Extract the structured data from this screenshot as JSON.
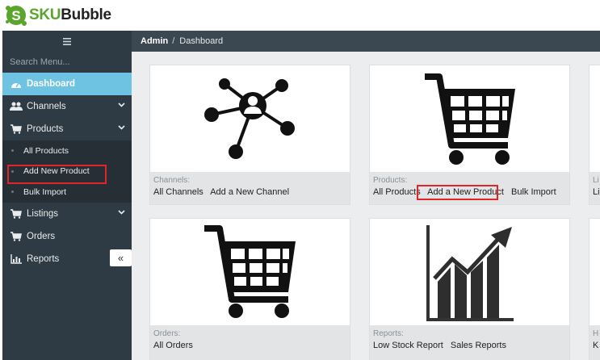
{
  "brand": {
    "name_green": "SKU",
    "name_dark": "Bubble"
  },
  "sidebar": {
    "search_placeholder": "Search Menu...",
    "items": [
      {
        "label": "Dashboard"
      },
      {
        "label": "Channels"
      },
      {
        "label": "Products"
      },
      {
        "label": "Listings"
      },
      {
        "label": "Orders"
      },
      {
        "label": "Reports"
      }
    ],
    "product_sub": [
      {
        "label": "All Products"
      },
      {
        "label": "Add New Product"
      },
      {
        "label": "Bulk Import"
      }
    ],
    "collapse_label": "«"
  },
  "breadcrumb": {
    "root": "Admin",
    "sep": "/",
    "current": "Dashboard"
  },
  "cards": {
    "channels": {
      "label": "Channels:",
      "links": [
        "All Channels",
        "Add a New Channel"
      ]
    },
    "products": {
      "label": "Products:",
      "links": [
        "All Products",
        "Add a New Product",
        "Bulk Import"
      ]
    },
    "orders": {
      "label": "Orders:",
      "links": [
        "All Orders"
      ]
    },
    "reports": {
      "label": "Reports:",
      "links": [
        "Low Stock Report",
        "Sales Reports"
      ]
    },
    "listings_partial": {
      "label": "Li",
      "links": [
        "Li"
      ]
    },
    "partial_bottom": {
      "label": "H",
      "links": [
        "K"
      ]
    }
  },
  "colors": {
    "accent": "#6ec3e3",
    "highlight": "#e2242b",
    "brand_green": "#5aa52b"
  }
}
